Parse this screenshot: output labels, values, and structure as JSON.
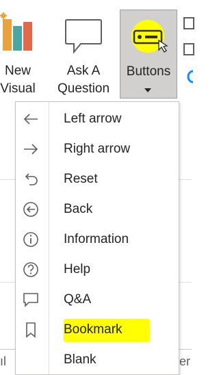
{
  "ribbon": {
    "new_visual": {
      "line1": "New",
      "line2": "Visual"
    },
    "ask_question": {
      "line1": "Ask A",
      "line2": "Question"
    },
    "buttons": {
      "label": "Buttons"
    }
  },
  "menu": {
    "items": [
      {
        "label": "Left arrow",
        "icon": "left-arrow-icon"
      },
      {
        "label": "Right arrow",
        "icon": "right-arrow-icon"
      },
      {
        "label": "Reset",
        "icon": "reset-icon"
      },
      {
        "label": "Back",
        "icon": "back-icon"
      },
      {
        "label": "Information",
        "icon": "information-icon"
      },
      {
        "label": "Help",
        "icon": "help-icon"
      },
      {
        "label": "Q&A",
        "icon": "qna-icon"
      },
      {
        "label": "Bookmark",
        "icon": "bookmark-icon"
      },
      {
        "label": "Blank",
        "icon": ""
      }
    ]
  },
  "colors": {
    "highlight": "#ffff00",
    "accent": "#118dff",
    "icon_stroke": "#605e5c",
    "selected_bg": "#d2d0ce"
  }
}
